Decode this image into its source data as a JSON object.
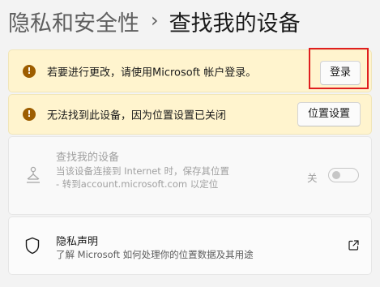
{
  "breadcrumb": {
    "parent": "隐私和安全性",
    "separator": "›",
    "current": "查找我的设备"
  },
  "notices": [
    {
      "icon": "warning-icon",
      "text": "若要进行更改，请使用Microsoft 帐户登录。",
      "button_label": "登录"
    },
    {
      "icon": "warning-icon",
      "text": "无法找到此设备，因为位置设置已关闭",
      "button_label": "位置设置"
    }
  ],
  "find_device": {
    "icon": "find-device-icon",
    "title": "查找我的设备",
    "description": "当该设备连接到 Internet 时，保存其位置 - 转到account.microsoft.com 以定位",
    "toggle_label": "关",
    "toggle_state": "off",
    "disabled": true
  },
  "privacy": {
    "icon": "shield-icon",
    "title": "隐私声明",
    "description": "了解 Microsoft 如何处理你的位置数据及其用途",
    "link_icon": "external-link-icon"
  },
  "colors": {
    "warning_bg": "#fff4ce",
    "warning_icon": "#9d5d00",
    "highlight": "#e01e1e"
  }
}
